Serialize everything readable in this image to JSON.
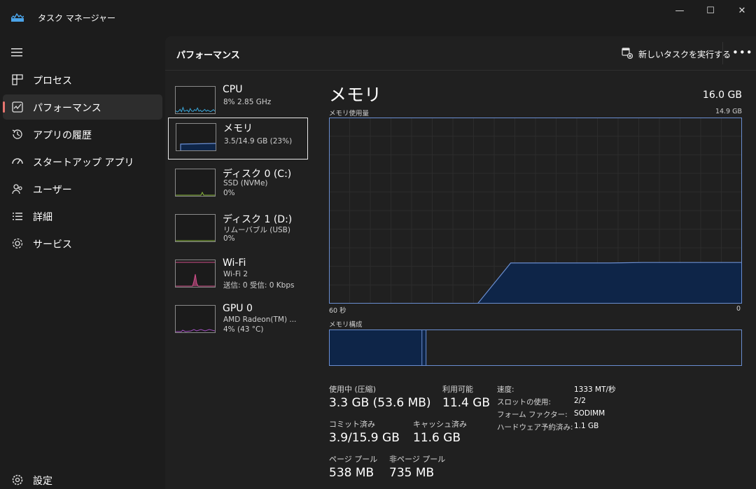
{
  "titlebar": {
    "title": "タスク マネージャー",
    "minimize": "—",
    "maximize": "☐",
    "close": "✕"
  },
  "sidebar": {
    "items": [
      {
        "label": "プロセス",
        "icon": "processes-icon"
      },
      {
        "label": "パフォーマンス",
        "icon": "performance-icon"
      },
      {
        "label": "アプリの履歴",
        "icon": "history-icon"
      },
      {
        "label": "スタートアップ アプリ",
        "icon": "startup-icon"
      },
      {
        "label": "ユーザー",
        "icon": "users-icon"
      },
      {
        "label": "詳細",
        "icon": "details-icon"
      },
      {
        "label": "サービス",
        "icon": "services-icon"
      }
    ],
    "settings_label": "設定"
  },
  "header": {
    "title": "パフォーマンス",
    "run_task_label": "新しいタスクを実行する",
    "more": "•••"
  },
  "devices": [
    {
      "name": "CPU",
      "line1": "8%  2.85 GHz",
      "line2": ""
    },
    {
      "name": "メモリ",
      "line1": "3.5/14.9 GB (23%)",
      "line2": ""
    },
    {
      "name": "ディスク 0 (C:)",
      "line1": "SSD (NVMe)",
      "line2": "0%"
    },
    {
      "name": "ディスク 1 (D:)",
      "line1": "リムーバブル (USB)",
      "line2": "0%"
    },
    {
      "name": "Wi-Fi",
      "line1": "Wi-Fi 2",
      "line2": "送信: 0 受信: 0 Kbps"
    },
    {
      "name": "GPU 0",
      "line1": "AMD Radeon(TM) ...",
      "line2": "4% (43 °C)"
    }
  ],
  "memory": {
    "title": "メモリ",
    "total": "16.0 GB",
    "usage_label": "メモリ使用量",
    "usage_max": "14.9 GB",
    "time_left": "60 秒",
    "time_right": "0",
    "composition_label": "メモリ構成",
    "usage_history_fraction": [
      0,
      0,
      0,
      0,
      0.93,
      0.93,
      0.93,
      0.93,
      0.94,
      0.94,
      0.94,
      0.94
    ],
    "composition": {
      "in_use_fraction": 0.225,
      "modified_fraction": 0.01
    },
    "stats": {
      "in_use_label": "使用中 (圧縮)",
      "in_use_value": "3.3 GB (53.6 MB)",
      "available_label": "利用可能",
      "available_value": "11.4 GB",
      "committed_label": "コミット済み",
      "committed_value": "3.9/15.9 GB",
      "cached_label": "キャッシュ済み",
      "cached_value": "11.6 GB",
      "paged_label": "ページ プール",
      "paged_value": "538 MB",
      "nonpaged_label": "非ページ プール",
      "nonpaged_value": "735 MB"
    },
    "specs": [
      {
        "label": "速度:",
        "value": "1333 MT/秒"
      },
      {
        "label": "スロットの使用:",
        "value": "2/2"
      },
      {
        "label": "フォーム ファクター:",
        "value": "SODIMM"
      },
      {
        "label": "ハードウェア予約済み:",
        "value": "1.1 GB"
      }
    ]
  },
  "colors": {
    "memory_accent": "#6a8ed1",
    "memory_fill": "#0e2548",
    "cpu_line": "#3aa6d8",
    "disk_line": "#8ab83a",
    "wifi_line": "#d04f8a",
    "gpu_line": "#a34fc2",
    "active_indicator": "#e7756f"
  }
}
